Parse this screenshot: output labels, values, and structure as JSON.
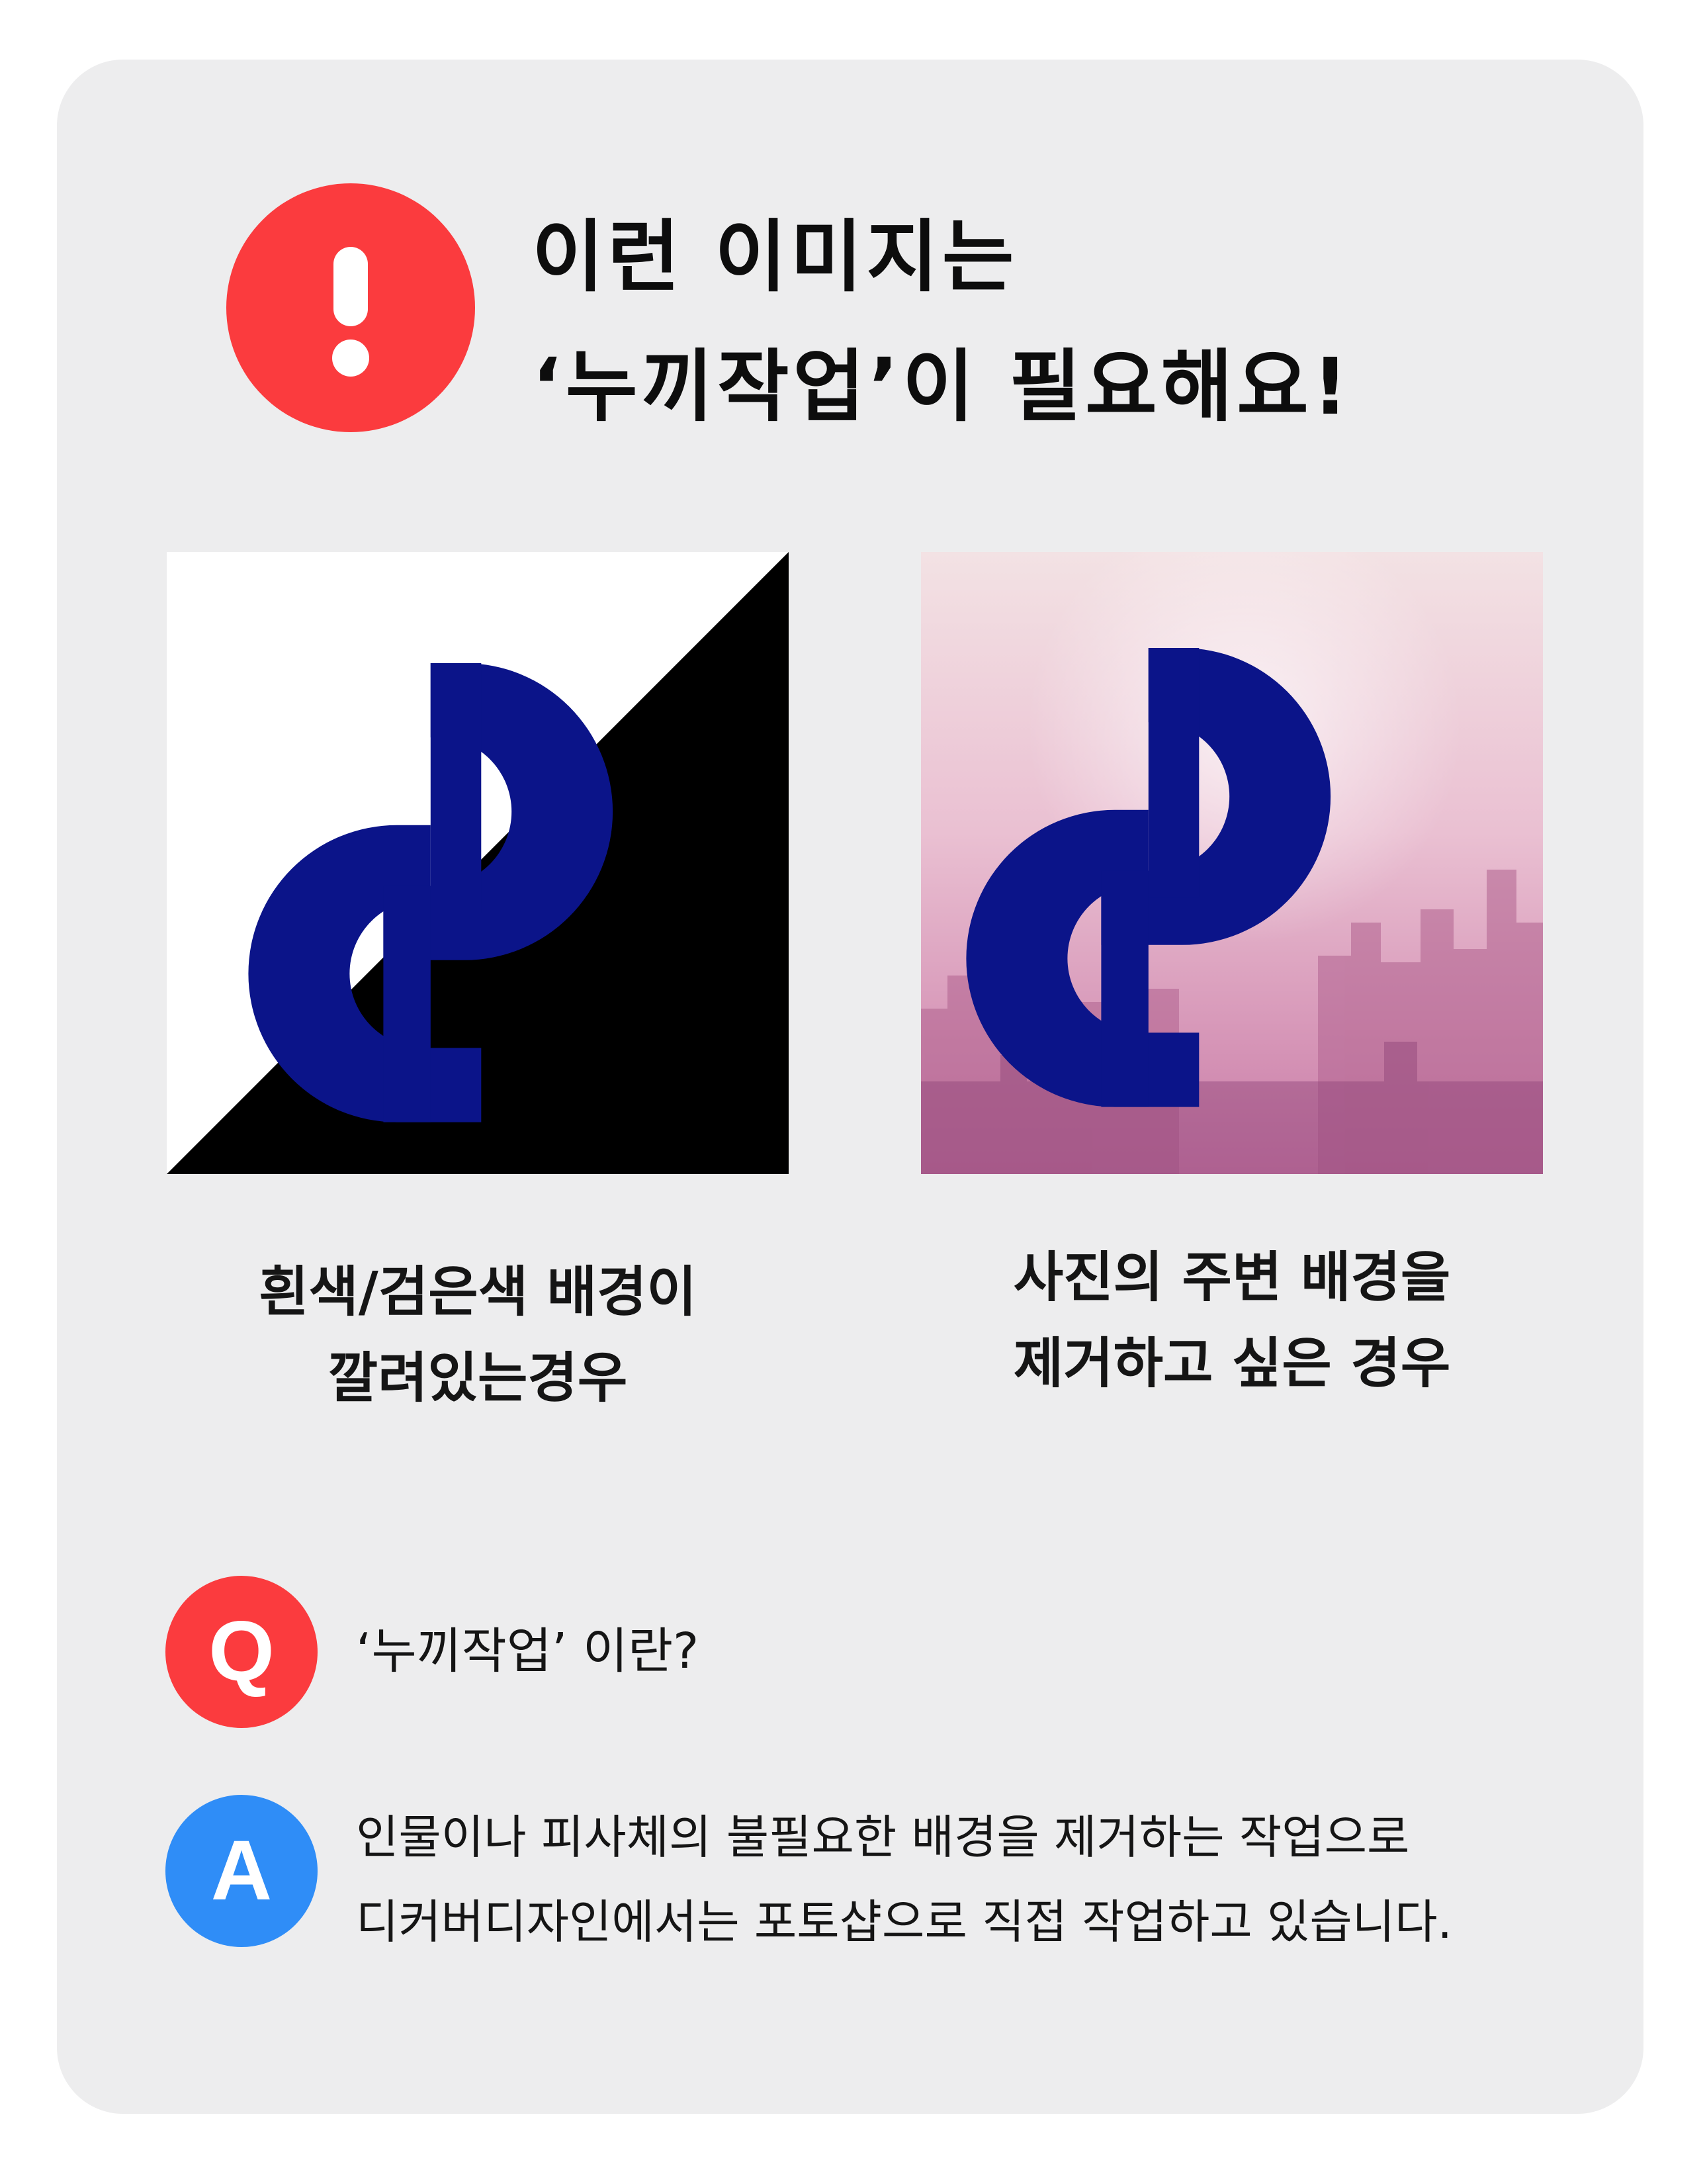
{
  "alert": {
    "icon": "exclamation-icon",
    "color": "#fb3b3e"
  },
  "headline": {
    "line1": "이런 이미지는",
    "line2": "‘누끼작업’이 필요해요!"
  },
  "examples": [
    {
      "image": "logo-on-split-white-black-background",
      "caption_line1": "흰색/검은색 배경이",
      "caption_line2": "깔려있는경우"
    },
    {
      "image": "logo-on-pink-city-photo-background",
      "caption_line1": "사진의 주변 배경을",
      "caption_line2": "제거하고 싶은 경우"
    }
  ],
  "qa": {
    "q_label": "Q",
    "q_color": "#fb3b3e",
    "question": "‘누끼작업’ 이란?",
    "a_label": "A",
    "a_color": "#2f8df7",
    "answer_line1": "인물이나 피사체의 불필요한 배경을 제거하는 작업으로",
    "answer_line2": "디커버디자인에서는 포토샵으로 직접 작업하고 있습니다."
  },
  "logo": {
    "color": "#0b1489"
  }
}
